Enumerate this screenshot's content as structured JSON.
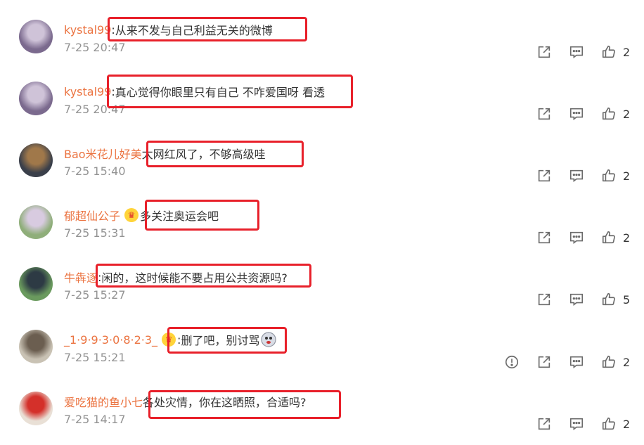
{
  "comments": [
    {
      "username": "kystal99",
      "separator": ":",
      "text": "从来不发与自己利益无关的微博",
      "time": "7-25 20:47",
      "likes": "2",
      "avatar_color": "#7b6a8e",
      "avatar_color2": "#cfc3d8",
      "has_crown": false,
      "has_report": false
    },
    {
      "username": "kystal99",
      "separator": ":",
      "text": "真心觉得你眼里只有自己 不咋爱国呀 看透",
      "time": "7-25 20:47",
      "likes": "2",
      "avatar_color": "#7b6a8e",
      "avatar_color2": "#cfc3d8",
      "has_crown": false,
      "has_report": false
    },
    {
      "username": "Bao米花儿好美",
      "separator": "",
      "text": "太网红风了，不够高级哇",
      "time": "7-25 15:40",
      "likes": "2",
      "avatar_color": "#3a3f4a",
      "avatar_color2": "#a0784a",
      "has_crown": false,
      "has_report": false
    },
    {
      "username": "郁超仙公子",
      "separator": "",
      "text": "多关注奥运会吧",
      "time": "7-25 15:31",
      "likes": "2",
      "avatar_color": "#8fae7a",
      "avatar_color2": "#d8cbe0",
      "has_crown": true,
      "has_report": false
    },
    {
      "username": "牛犇逐",
      "separator": ":",
      "text": "闲的，这时候能不要占用公共资源吗?",
      "time": "7-25 15:27",
      "likes": "5",
      "avatar_color": "#6a9a5e",
      "avatar_color2": "#2d3a44",
      "has_crown": false,
      "has_report": false
    },
    {
      "username": "_1·9·9·3·0·8·2·3_",
      "separator": ":",
      "text": "删了吧，别讨骂",
      "time": "7-25 15:21",
      "likes": "2",
      "avatar_color": "#c9c2b4",
      "avatar_color2": "#6b5e50",
      "has_crown": true,
      "has_report": true
    },
    {
      "username": "爱吃猫的鱼小七",
      "separator": "",
      "text": "各处灾情，你在这晒照，合适吗?",
      "time": "7-25 14:17",
      "likes": "2",
      "avatar_color": "#e9e0d6",
      "avatar_color2": "#d4302a",
      "has_crown": false,
      "has_report": false
    }
  ],
  "icons": {
    "share": "share-icon",
    "comment": "comment-icon",
    "like": "like-icon",
    "report": "report-icon",
    "crown": "crown-badge-icon",
    "emoji": "emoji-icon"
  },
  "colors": {
    "username": "#eb7340",
    "time": "#939393",
    "highlight": "#e8202a"
  }
}
